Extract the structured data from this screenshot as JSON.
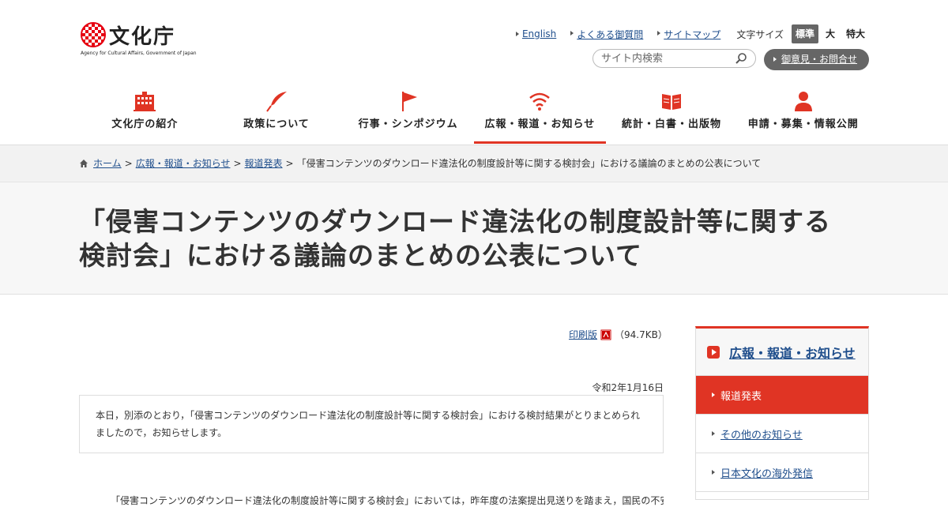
{
  "header": {
    "logo": {
      "name": "文化庁",
      "sub": "Agency for Cultural Affairs, Government of Japan"
    },
    "utility_links": [
      "English",
      "よくある御質問",
      "サイトマップ"
    ],
    "font_size": {
      "label": "文字サイズ",
      "options": [
        "標準",
        "大",
        "特大"
      ],
      "active": "標準"
    },
    "search": {
      "placeholder": "サイト内検索"
    },
    "contact_label": "御意見・お問合せ"
  },
  "nav": [
    {
      "label": "文化庁の紹介",
      "icon": "building-icon"
    },
    {
      "label": "政策について",
      "icon": "feather-icon"
    },
    {
      "label": "行事・シンポジウム",
      "icon": "flag-icon"
    },
    {
      "label": "広報・報道・お知らせ",
      "icon": "wifi-icon",
      "active": true
    },
    {
      "label": "統計・白書・出版物",
      "icon": "book-icon"
    },
    {
      "label": "申請・募集・情報公開",
      "icon": "person-icon"
    }
  ],
  "breadcrumb": {
    "items": [
      "ホーム",
      "広報・報道・お知らせ",
      "報道発表"
    ],
    "current": "「侵害コンテンツのダウンロード違法化の制度設計等に関する検討会」における議論のまとめの公表について"
  },
  "page_title_line1": "「侵害コンテンツのダウンロード違法化の制度設計等に関する",
  "page_title_line2": "検討会」における議論のまとめの公表について",
  "print": {
    "label": "印刷版",
    "size": "（94.7KB）"
  },
  "date": "令和2年1月16日",
  "lead": "本日，別添のとおり，「侵害コンテンツのダウンロード違法化の制度設計等に関する検討会」における検討結果がとりまとめられましたので，お知らせします。",
  "body_cut": "「侵害コンテンツのダウンロード違法化の制度設計等に関する検討会」においては，昨年度の法案提出見送りを踏まえ，国民の不安・懸念にも十分に配慮した結果",
  "sidebar": {
    "heading": "広報・報道・お知らせ",
    "items": [
      "報道発表",
      "その他のお知らせ",
      "日本文化の海外発信"
    ],
    "active_index": 0
  },
  "colors": {
    "accent": "#e03424",
    "link": "#1f4e8c",
    "gray_button": "#666666"
  }
}
